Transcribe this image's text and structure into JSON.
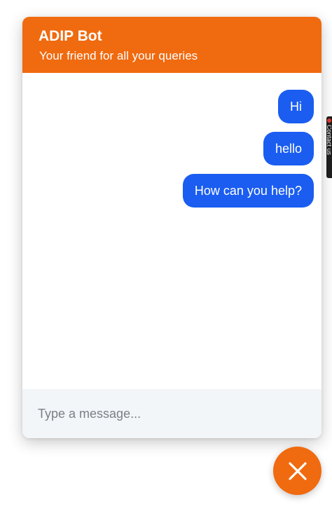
{
  "chat": {
    "title": "ADIP Bot",
    "subtitle": "Your friend for all your queries",
    "messages": [
      {
        "sender": "user",
        "text": "Hi"
      },
      {
        "sender": "user",
        "text": "hello"
      },
      {
        "sender": "user",
        "text": "How can you help?"
      }
    ],
    "input": {
      "placeholder": "Type a message...",
      "value": ""
    }
  },
  "fab": {
    "icon": "close-icon"
  },
  "side_tab": {
    "label": "Contact us"
  },
  "colors": {
    "header_bg": "#f06a0f",
    "bubble_bg": "#1a5df0",
    "composer_bg": "#f3f6f9",
    "fab_bg": "#f06a0f",
    "text_on_color": "#ffffff"
  }
}
